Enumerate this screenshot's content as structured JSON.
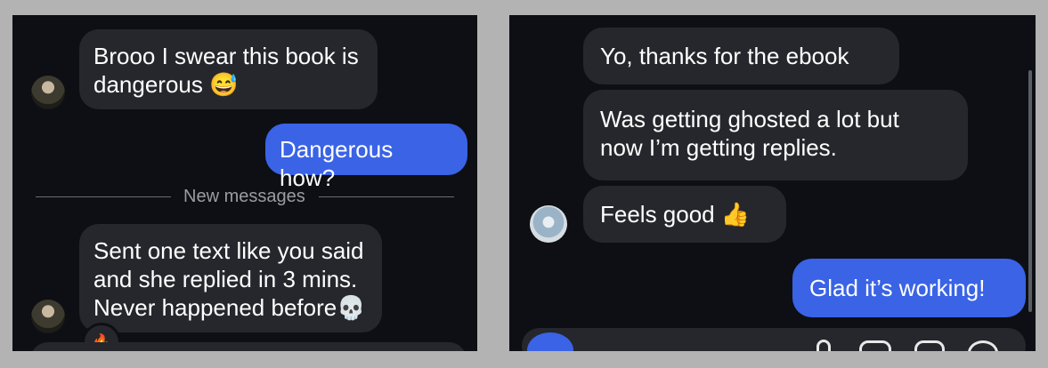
{
  "left_panel": {
    "messages": [
      {
        "text": "Brooo I swear this book is\ndangerous 😅",
        "sender": "received"
      },
      {
        "text": "Dangerous how?",
        "sender": "sent"
      },
      {
        "text": "Sent one text like you said\nand she replied in 3 mins.\nNever happened before💀",
        "sender": "received"
      }
    ],
    "divider_label": "New messages",
    "reaction_emoji": "🔥"
  },
  "right_panel": {
    "messages": [
      {
        "text": "Yo, thanks for the ebook",
        "sender": "received"
      },
      {
        "text": "Was getting ghosted a lot but\nnow I’m getting replies.",
        "sender": "received"
      },
      {
        "text": "Feels good 👍",
        "sender": "received"
      },
      {
        "text": "Glad it’s working!",
        "sender": "sent"
      }
    ]
  },
  "colors": {
    "sent_bubble": "#3a63e6",
    "received_bubble": "#25272c",
    "background": "#0d0f14"
  }
}
